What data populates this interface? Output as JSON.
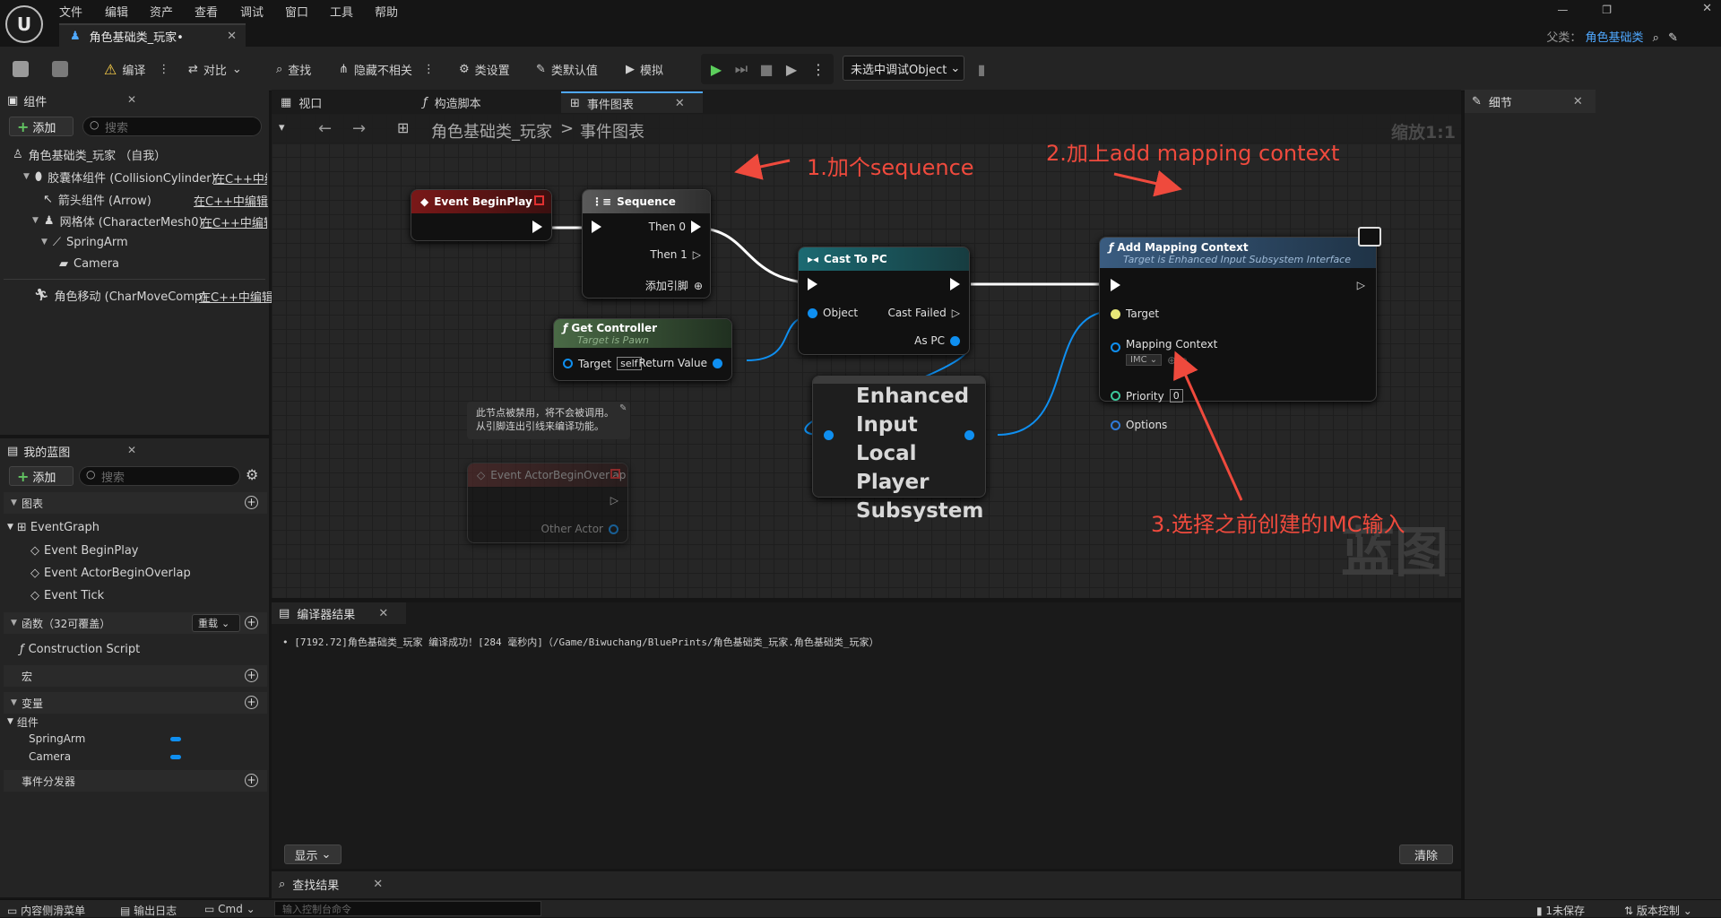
{
  "menu": [
    "文件",
    "编辑",
    "资产",
    "查看",
    "调试",
    "窗口",
    "工具",
    "帮助"
  ],
  "doc_tab": "角色基础类_玩家•",
  "parent_label": "父类：",
  "parent_value": "角色基础类",
  "toolbar": {
    "compile": "编译",
    "diff": "对比",
    "find": "查找",
    "hide_unrelated": "隐藏不相关",
    "class_settings": "类设置",
    "class_defaults": "类默认值",
    "simulate": "模拟",
    "debug_object": "未选中调试Object"
  },
  "components_panel": {
    "title": "组件",
    "add": "添加",
    "search_placeholder": "搜索",
    "tree": [
      {
        "label": "角色基础类_玩家 （自我）",
        "link": ""
      },
      {
        "label": "胶囊体组件 (CollisionCylinder)",
        "link": "在C++中编"
      },
      {
        "label": "箭头组件 (Arrow)",
        "link": "在C++中编辑"
      },
      {
        "label": "网格体 (CharacterMesh0)",
        "link": "在C++中编辑"
      },
      {
        "label": "SpringArm",
        "link": ""
      },
      {
        "label": "Camera",
        "link": ""
      },
      {
        "label": "角色移动 (CharMoveComp)",
        "link": "在C++中编辑"
      }
    ]
  },
  "my_blueprint": {
    "title": "我的蓝图",
    "add": "添加",
    "search_placeholder": "搜索",
    "graphs_header": "图表",
    "event_graph": "EventGraph",
    "events": [
      "Event BeginPlay",
      "Event ActorBeginOverlap",
      "Event Tick"
    ],
    "functions_header": "函数（32可覆盖）",
    "override": "重载",
    "construction_script": "Construction Script",
    "macros_header": "宏",
    "variables_header": "变量",
    "components_sub": "组件",
    "variables": [
      "SpringArm",
      "Camera"
    ],
    "dispatchers_header": "事件分发器"
  },
  "graph_tabs": [
    "视口",
    "构造脚本",
    "事件图表"
  ],
  "breadcrumb": {
    "root": "角色基础类_玩家",
    "sep": ">",
    "current": "事件图表"
  },
  "zoom": "缩放1:1",
  "watermark": "蓝图",
  "nodes": {
    "begin_play": "Event BeginPlay",
    "sequence": "Sequence",
    "then0": "Then 0",
    "then1": "Then 1",
    "add_pin": "添加引脚",
    "cast": "Cast To PC",
    "object": "Object",
    "cast_failed": "Cast Failed",
    "as_pc": "As PC",
    "get_controller": "Get Controller",
    "target_is_pawn": "Target is Pawn",
    "target": "Target",
    "self": "self",
    "return_value": "Return Value",
    "subsystem": "Enhanced Input Local Player Subsystem",
    "add_mapping": "Add Mapping Context",
    "add_mapping_sub": "Target is Enhanced Input Subsystem Interface",
    "mapping_context": "Mapping Context",
    "imc": "IMC",
    "priority": "Priority",
    "priority_val": "0",
    "options": "Options",
    "disabled_comment": "此节点被禁用，将不会被调用。\n从引脚连出引线来编译功能。",
    "overlap": "Event ActorBeginOverlap",
    "other_actor": "Other Actor"
  },
  "annotations": [
    "1.加个sequence",
    "2.加上add mapping context",
    "3.选择之前创建的IMC输入"
  ],
  "compiler": {
    "title": "编译器结果",
    "message": "[7192.72]角色基础类_玩家 编译成功！[284 毫秒内]（/Game/Biwuchang/BluePrints/角色基础类_玩家.角色基础类_玩家）",
    "show": "显示",
    "clear": "清除"
  },
  "find_results": "查找结果",
  "details_title": "细节",
  "status": {
    "content_drawer": "内容侧滑菜单",
    "output_log": "输出日志",
    "cmd": "Cmd",
    "cmd_placeholder": "输入控制台命令",
    "unsaved": "1未保存",
    "source_control": "版本控制"
  },
  "colors": {
    "accent_link": "#4fa8ff",
    "annotation": "#ef4a3d",
    "wire_blue": "#0f8ff0"
  }
}
